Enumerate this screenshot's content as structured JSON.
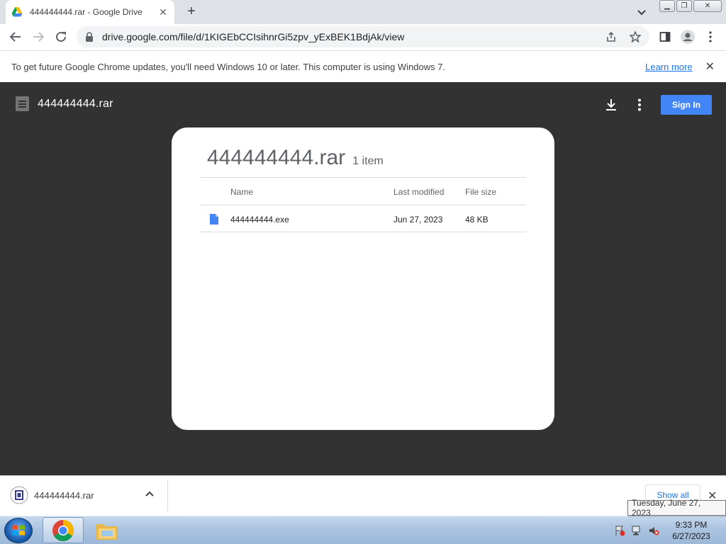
{
  "browser": {
    "tab_title": "444444444.rar - Google Drive",
    "url": "drive.google.com/file/d/1KIGEbCCIsihnrGi5zpv_yExBEK1BdjAk/view"
  },
  "infobar": {
    "message": "To get future Google Chrome updates, you'll need Windows 10 or later. This computer is using Windows 7.",
    "link": "Learn more"
  },
  "viewer": {
    "title": "444444444.rar",
    "sign_in": "Sign In",
    "archive": {
      "title": "444444444.rar",
      "count": "1 item",
      "headers": {
        "name": "Name",
        "modified": "Last modified",
        "size": "File size"
      },
      "files": [
        {
          "name": "444444444.exe",
          "modified": "Jun 27, 2023",
          "size": "48 KB"
        }
      ]
    }
  },
  "downloads": {
    "file": "444444444.rar",
    "show_all": "Show all"
  },
  "taskbar": {
    "tooltip": "Tuesday, June 27, 2023",
    "time": "9:33 PM",
    "date": "6/27/2023"
  },
  "colors": {
    "accent": "#4285f4",
    "viewer_bg": "#323232",
    "link": "#1a73e8"
  }
}
